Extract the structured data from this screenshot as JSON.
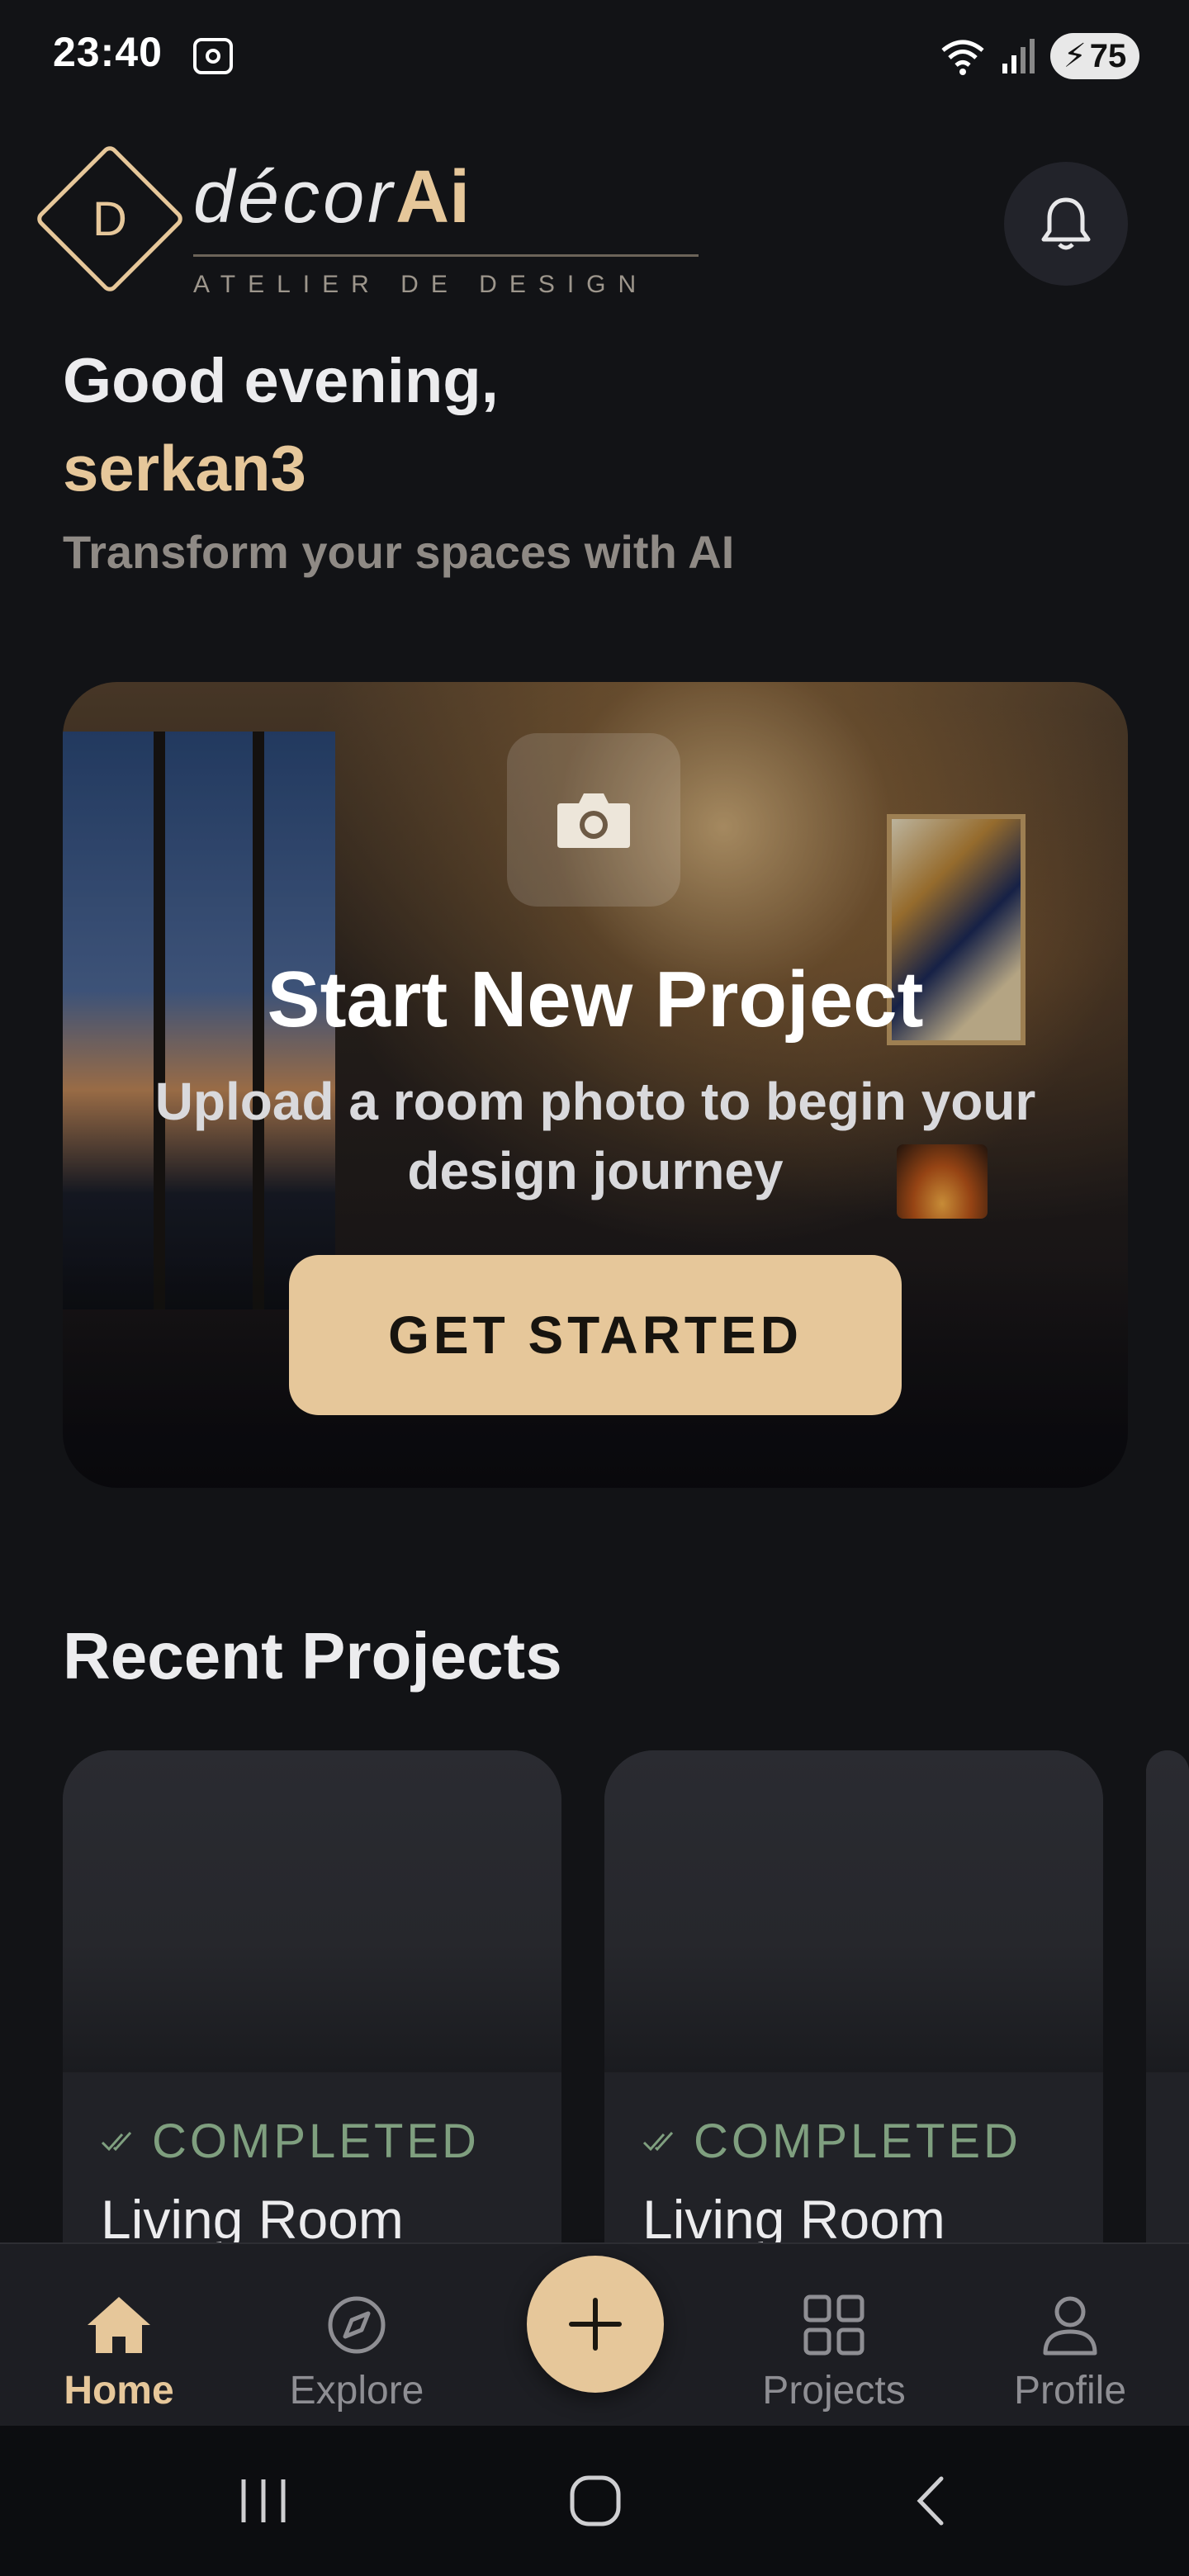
{
  "status_bar": {
    "time": "23:40",
    "battery": "75"
  },
  "header": {
    "logo_letter": "D",
    "brand_prefix": "décor",
    "brand_suffix": "Ai",
    "tagline": "ATELIER DE DESIGN"
  },
  "greeting": {
    "salutation": "Good evening,",
    "username": "serkan3",
    "subtitle": "Transform your spaces with AI"
  },
  "hero": {
    "title": "Start New Project",
    "subtitle": "Upload a room photo to begin your design journey",
    "cta_label": "GET STARTED"
  },
  "recent": {
    "title": "Recent Projects",
    "projects": [
      {
        "status": "COMPLETED",
        "name": "Living Room"
      },
      {
        "status": "COMPLETED",
        "name": "Living Room"
      }
    ]
  },
  "bottom_nav": {
    "items": [
      {
        "label": "Home",
        "icon": "home-icon",
        "active": true
      },
      {
        "label": "Explore",
        "icon": "compass-icon",
        "active": false
      },
      {
        "label": "Projects",
        "icon": "grid-icon",
        "active": false
      },
      {
        "label": "Profile",
        "icon": "user-icon",
        "active": false
      }
    ]
  },
  "colors": {
    "accent": "#E6C79A",
    "background": "#121316",
    "status_completed": "#7F9F7F"
  }
}
